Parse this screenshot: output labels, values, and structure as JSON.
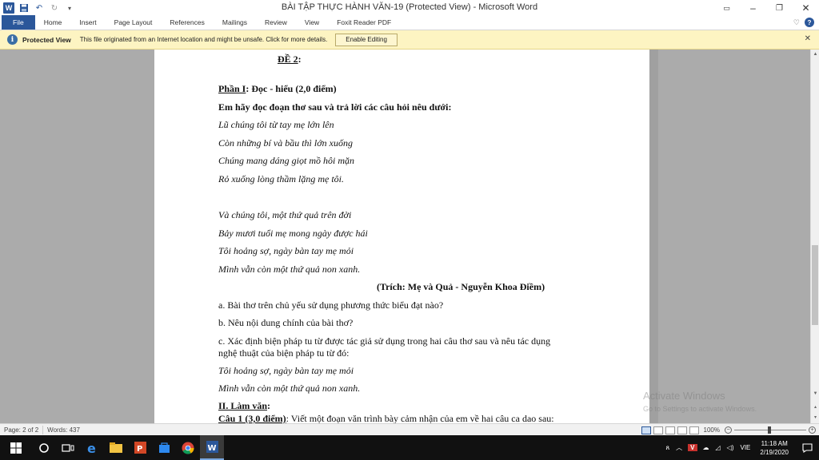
{
  "window": {
    "title": "BÀI TẬP THỰC HÀNH VĂN-19 (Protected View)  -  Microsoft Word",
    "app_icon_label": "W"
  },
  "ribbon": {
    "tabs": [
      "File",
      "Home",
      "Insert",
      "Page Layout",
      "References",
      "Mailings",
      "Review",
      "View",
      "Foxit Reader PDF"
    ]
  },
  "protected_view": {
    "title": "Protected View",
    "message": "This file originated from an Internet location and might be unsafe. Click for more details.",
    "button_label": "Enable Editing"
  },
  "document": {
    "lines": [
      {
        "text": "ĐỀ 2",
        "suffix": ":"
      },
      {
        "text": "Phần I",
        "suffix": ": Đọc - hiểu (2,0 điểm)"
      },
      {
        "text": "Em hãy đọc đoạn thơ sau và trả lời các câu hỏi nêu dưới:"
      },
      {
        "text": "Lũ chúng tôi từ tay mẹ lớn lên"
      },
      {
        "text": "Còn những bí và bầu thì lớn xuống"
      },
      {
        "text": "Chúng mang dáng giọt mồ  hôi mặn"
      },
      {
        "text": "Rỏ xuống lòng thầm lặng mẹ tôi."
      },
      {
        "text": "Và chúng tôi, một thứ quả trên đời"
      },
      {
        "text": "Bảy mươi  tuổi mẹ mong ngày được hái"
      },
      {
        "text": "Tôi hoảng sợ,  ngày bàn tay mẹ mỏi"
      },
      {
        "text": "Mình vẫn còn một thứ quả non xanh."
      },
      {
        "text": "(Trích: Mẹ và Quả - Nguyễn Khoa Điềm)"
      },
      {
        "text": "a. Bài thơ trên chủ yếu sử dụng phương thức biểu đạt nào?"
      },
      {
        "text": "b. Nêu nội dung chính của bài thơ?"
      },
      {
        "text": "c. Xác định  biện pháp tu từ được tác giả sử dụng trong hai câu thơ sau và nêu tác dụng"
      },
      {
        "text": "nghệ thuật của biện pháp tu từ đó:"
      },
      {
        "text": "Tôi hoảng sợ,  ngày bàn tay mẹ mỏi"
      },
      {
        "text": "Mình vẫn còn một thứ quả non xanh."
      },
      {
        "text": "II. Làm văn",
        "suffix": ":"
      },
      {
        "text": "Câu 1 (3,0 điểm)",
        "suffix": ": Viết một đoạn văn trình bày cảm nhận của em về hai câu ca dao sau:"
      }
    ]
  },
  "watermark": {
    "line1": "Activate Windows",
    "line2": "Go to Settings to activate Windows."
  },
  "status": {
    "page": "Page: 2 of 2",
    "words": "Words: 437",
    "zoom": "100%"
  },
  "taskbar": {
    "language": "VIE",
    "time": "11:18 AM",
    "date": "2/19/2020"
  },
  "colors": {
    "word_blue": "#2b579a",
    "protected_bar": "#fdf4c2",
    "doc_background": "#ababab"
  }
}
